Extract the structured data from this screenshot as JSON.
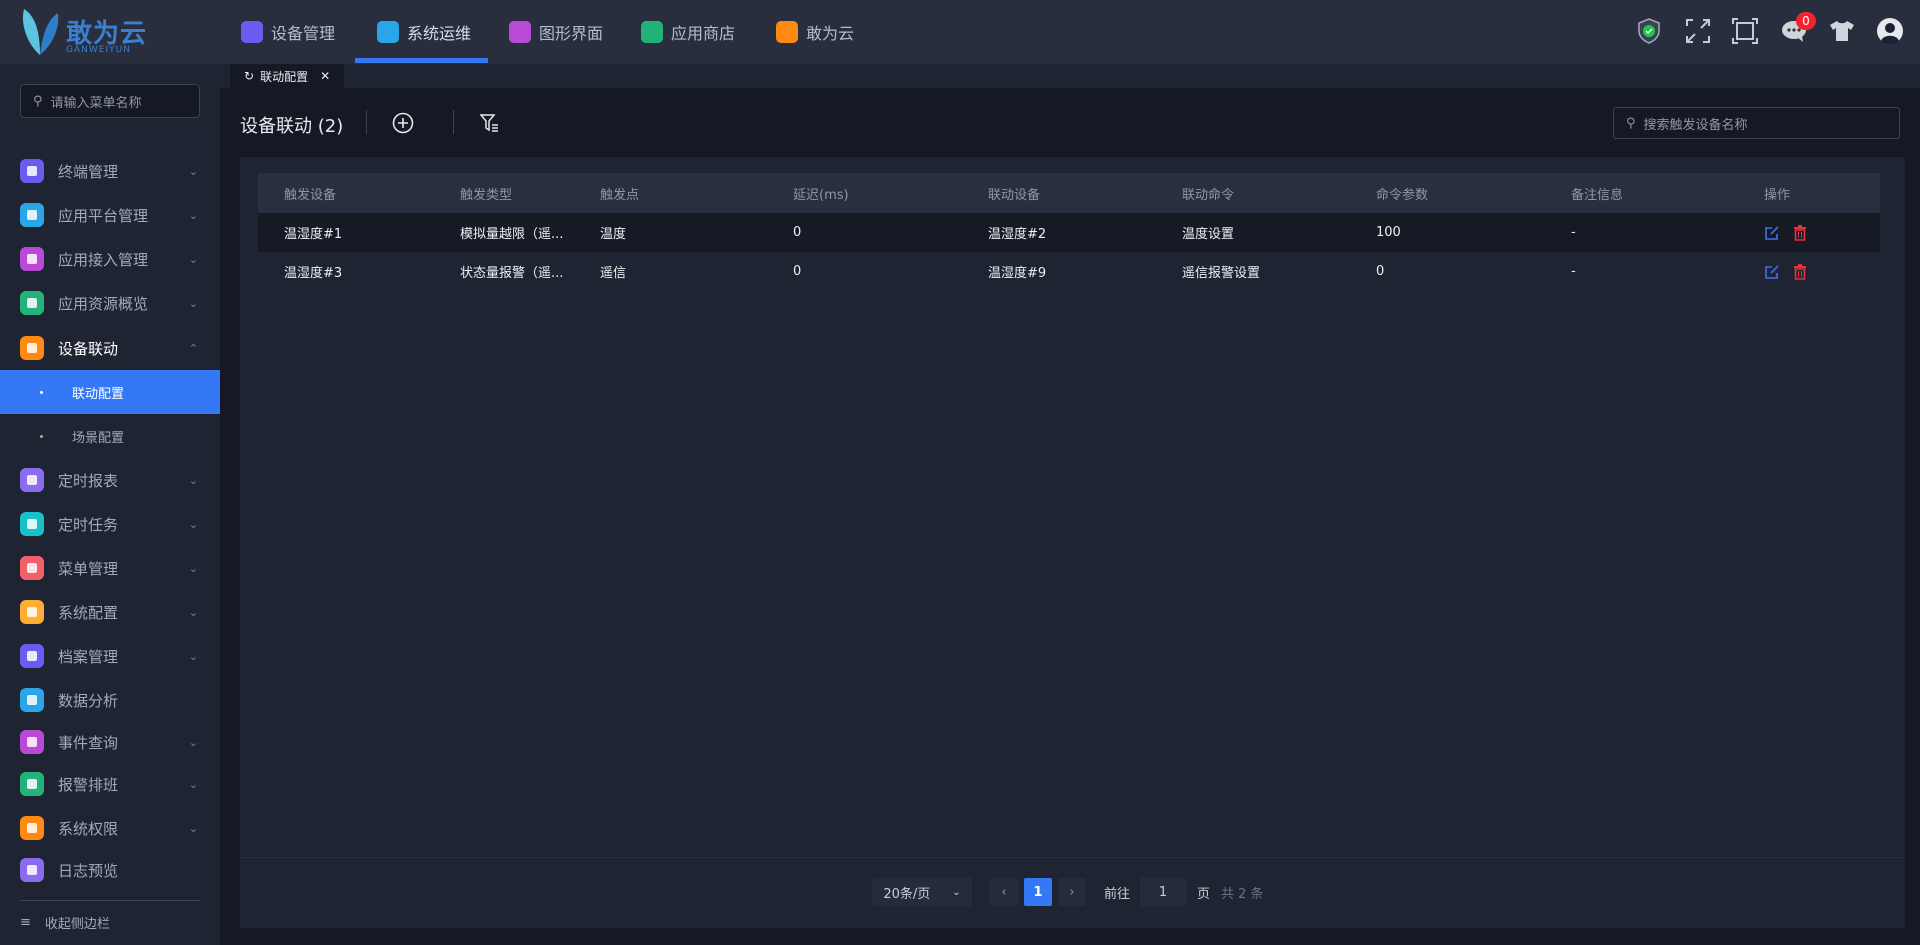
{
  "app": {
    "logo_text": "敢为云",
    "logo_sub": "GANWEIYUN"
  },
  "topnav": [
    {
      "label": "设备管理",
      "color": "#6a5cf0"
    },
    {
      "label": "系统运维",
      "color": "#2aa6e8",
      "active": true
    },
    {
      "label": "图形界面",
      "color": "#b84ad6"
    },
    {
      "label": "应用商店",
      "color": "#23b27a"
    },
    {
      "label": "敢为云",
      "color": "#ff8a12"
    }
  ],
  "toolbar": {
    "notification_count": "0"
  },
  "sidebar": {
    "search_placeholder": "请输入菜单名称",
    "items": [
      {
        "label": "终端管理",
        "color": "#6a5cf0"
      },
      {
        "label": "应用平台管理",
        "color": "#2aa6e8"
      },
      {
        "label": "应用接入管理",
        "color": "#b84ad6"
      },
      {
        "label": "应用资源概览",
        "color": "#23b27a"
      },
      {
        "label": "设备联动",
        "color": "#ff8a12"
      },
      {
        "label": "定时报表",
        "color": "#8b6cf0"
      },
      {
        "label": "定时任务",
        "color": "#18c1c9"
      },
      {
        "label": "菜单管理",
        "color": "#f2606a"
      },
      {
        "label": "系统配置",
        "color": "#ffae33"
      },
      {
        "label": "档案管理",
        "color": "#6a5cf0"
      },
      {
        "label": "数据分析",
        "color": "#2aa6e8"
      },
      {
        "label": "事件查询",
        "color": "#b84ad6"
      },
      {
        "label": "报警排班",
        "color": "#23b27a"
      },
      {
        "label": "系统权限",
        "color": "#ff8a12"
      },
      {
        "label": "日志预览",
        "color": "#8b6cf0"
      }
    ],
    "subitems": [
      {
        "label": "联动配置"
      },
      {
        "label": "场景配置"
      }
    ],
    "collapse_label": "收起侧边栏"
  },
  "tab": {
    "label": "联动配置"
  },
  "page": {
    "title": "设备联动 (2)",
    "search_placeholder": "搜索触发设备名称"
  },
  "table": {
    "columns": [
      "触发设备",
      "触发类型",
      "触发点",
      "延迟(ms)",
      "联动设备",
      "联动命令",
      "命令参数",
      "备注信息",
      "操作"
    ],
    "rows": [
      [
        "温湿度#1",
        "模拟量越限（遥...",
        "温度",
        "0",
        "温湿度#2",
        "温度设置",
        "100",
        "-"
      ],
      [
        "温湿度#3",
        "状态量报警（遥...",
        "遥信",
        "0",
        "温湿度#9",
        "遥信报警设置",
        "0",
        "-"
      ]
    ]
  },
  "pagination": {
    "page_size": "20条/页",
    "current": "1",
    "goto_label": "前往",
    "goto_value": "1",
    "page_unit": "页",
    "total": "共 2 条"
  }
}
